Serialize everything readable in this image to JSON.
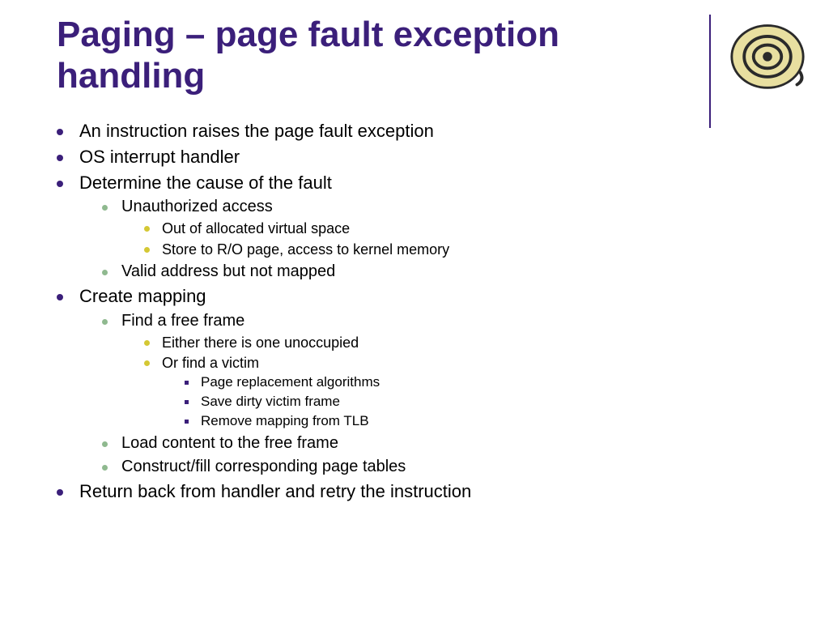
{
  "title": "Paging – page fault exception handling",
  "bullets": [
    {
      "text": "An instruction raises the page fault exception"
    },
    {
      "text": "OS interrupt handler"
    },
    {
      "text": "Determine the cause of the fault",
      "children": [
        {
          "text": "Unauthorized access",
          "children": [
            {
              "text": "Out of allocated virtual space"
            },
            {
              "text": "Store to R/O page, access to kernel memory"
            }
          ]
        },
        {
          "text": "Valid address but not mapped"
        }
      ]
    },
    {
      "text": "Create mapping",
      "children": [
        {
          "text": "Find a free frame",
          "children": [
            {
              "text": "Either there is one unoccupied"
            },
            {
              "text": "Or find a victim",
              "children": [
                {
                  "text": "Page replacement algorithms"
                },
                {
                  "text": "Save dirty victim frame"
                },
                {
                  "text": "Remove mapping from TLB"
                }
              ]
            }
          ]
        },
        {
          "text": "Load content to the free frame"
        },
        {
          "text": "Construct/fill corresponding page tables"
        }
      ]
    },
    {
      "text": "Return back from handler and retry the instruction"
    }
  ]
}
